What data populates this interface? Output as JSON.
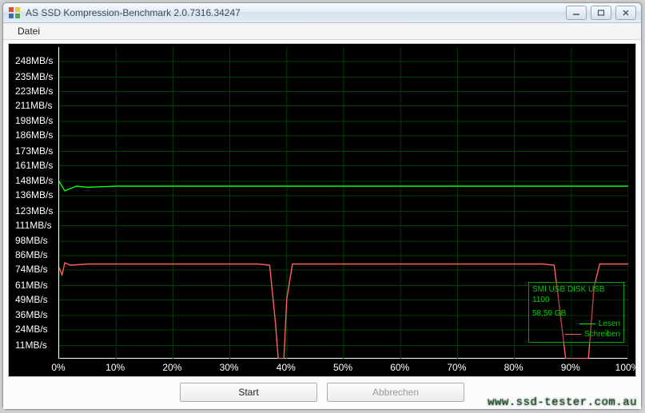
{
  "window": {
    "title": "AS SSD Kompression-Benchmark 2.0.7316.34247"
  },
  "menu": {
    "file": "Datei"
  },
  "buttons": {
    "start": "Start",
    "cancel": "Abbrechen"
  },
  "device": {
    "name": "SMI USB DISK USB 1100",
    "capacity": "58,59 GB"
  },
  "legend": {
    "read": "Lesen",
    "write": "Schreiben",
    "read_color": "#00ff00",
    "write_color": "#ff6060"
  },
  "watermark": "www.ssd-tester.com.au",
  "chart_data": {
    "type": "line",
    "title": "",
    "xlabel": "",
    "ylabel": "",
    "xlim": [
      0,
      100
    ],
    "ylim": [
      0,
      260
    ],
    "x_ticks": [
      "0%",
      "10%",
      "20%",
      "30%",
      "40%",
      "50%",
      "60%",
      "70%",
      "80%",
      "90%",
      "100%"
    ],
    "y_ticks": [
      "11MB/s",
      "24MB/s",
      "36MB/s",
      "49MB/s",
      "61MB/s",
      "74MB/s",
      "86MB/s",
      "98MB/s",
      "111MB/s",
      "123MB/s",
      "136MB/s",
      "148MB/s",
      "161MB/s",
      "173MB/s",
      "186MB/s",
      "198MB/s",
      "211MB/s",
      "223MB/s",
      "235MB/s",
      "248MB/s"
    ],
    "y_tick_values": [
      11,
      24,
      36,
      49,
      61,
      74,
      86,
      98,
      111,
      123,
      136,
      148,
      161,
      173,
      186,
      198,
      211,
      223,
      235,
      248
    ],
    "series": [
      {
        "name": "Lesen",
        "color": "#00ff00",
        "points": [
          {
            "x": 0,
            "y": 148
          },
          {
            "x": 1,
            "y": 140
          },
          {
            "x": 3,
            "y": 144
          },
          {
            "x": 5,
            "y": 143
          },
          {
            "x": 10,
            "y": 144
          },
          {
            "x": 15,
            "y": 144
          },
          {
            "x": 20,
            "y": 144
          },
          {
            "x": 25,
            "y": 144
          },
          {
            "x": 30,
            "y": 144
          },
          {
            "x": 35,
            "y": 144
          },
          {
            "x": 40,
            "y": 144
          },
          {
            "x": 45,
            "y": 144
          },
          {
            "x": 50,
            "y": 144
          },
          {
            "x": 55,
            "y": 144
          },
          {
            "x": 60,
            "y": 144
          },
          {
            "x": 65,
            "y": 144
          },
          {
            "x": 70,
            "y": 144
          },
          {
            "x": 75,
            "y": 144
          },
          {
            "x": 80,
            "y": 144
          },
          {
            "x": 85,
            "y": 144
          },
          {
            "x": 90,
            "y": 144
          },
          {
            "x": 95,
            "y": 144
          },
          {
            "x": 100,
            "y": 144
          }
        ]
      },
      {
        "name": "Schreiben",
        "color": "#ff6060",
        "points": [
          {
            "x": 0,
            "y": 76
          },
          {
            "x": 0.5,
            "y": 70
          },
          {
            "x": 1,
            "y": 80
          },
          {
            "x": 2,
            "y": 78
          },
          {
            "x": 5,
            "y": 79
          },
          {
            "x": 10,
            "y": 79
          },
          {
            "x": 15,
            "y": 79
          },
          {
            "x": 20,
            "y": 79
          },
          {
            "x": 25,
            "y": 79
          },
          {
            "x": 30,
            "y": 79
          },
          {
            "x": 35,
            "y": 79
          },
          {
            "x": 37,
            "y": 78
          },
          {
            "x": 38,
            "y": 30
          },
          {
            "x": 38.5,
            "y": 0
          },
          {
            "x": 39.5,
            "y": 0
          },
          {
            "x": 40,
            "y": 50
          },
          {
            "x": 41,
            "y": 79
          },
          {
            "x": 45,
            "y": 79
          },
          {
            "x": 50,
            "y": 79
          },
          {
            "x": 55,
            "y": 79
          },
          {
            "x": 60,
            "y": 79
          },
          {
            "x": 65,
            "y": 79
          },
          {
            "x": 70,
            "y": 79
          },
          {
            "x": 75,
            "y": 79
          },
          {
            "x": 80,
            "y": 79
          },
          {
            "x": 85,
            "y": 79
          },
          {
            "x": 87,
            "y": 78
          },
          {
            "x": 88,
            "y": 40
          },
          {
            "x": 89,
            "y": 0
          },
          {
            "x": 93,
            "y": 0
          },
          {
            "x": 94,
            "y": 60
          },
          {
            "x": 95,
            "y": 79
          },
          {
            "x": 100,
            "y": 79
          }
        ]
      }
    ]
  }
}
